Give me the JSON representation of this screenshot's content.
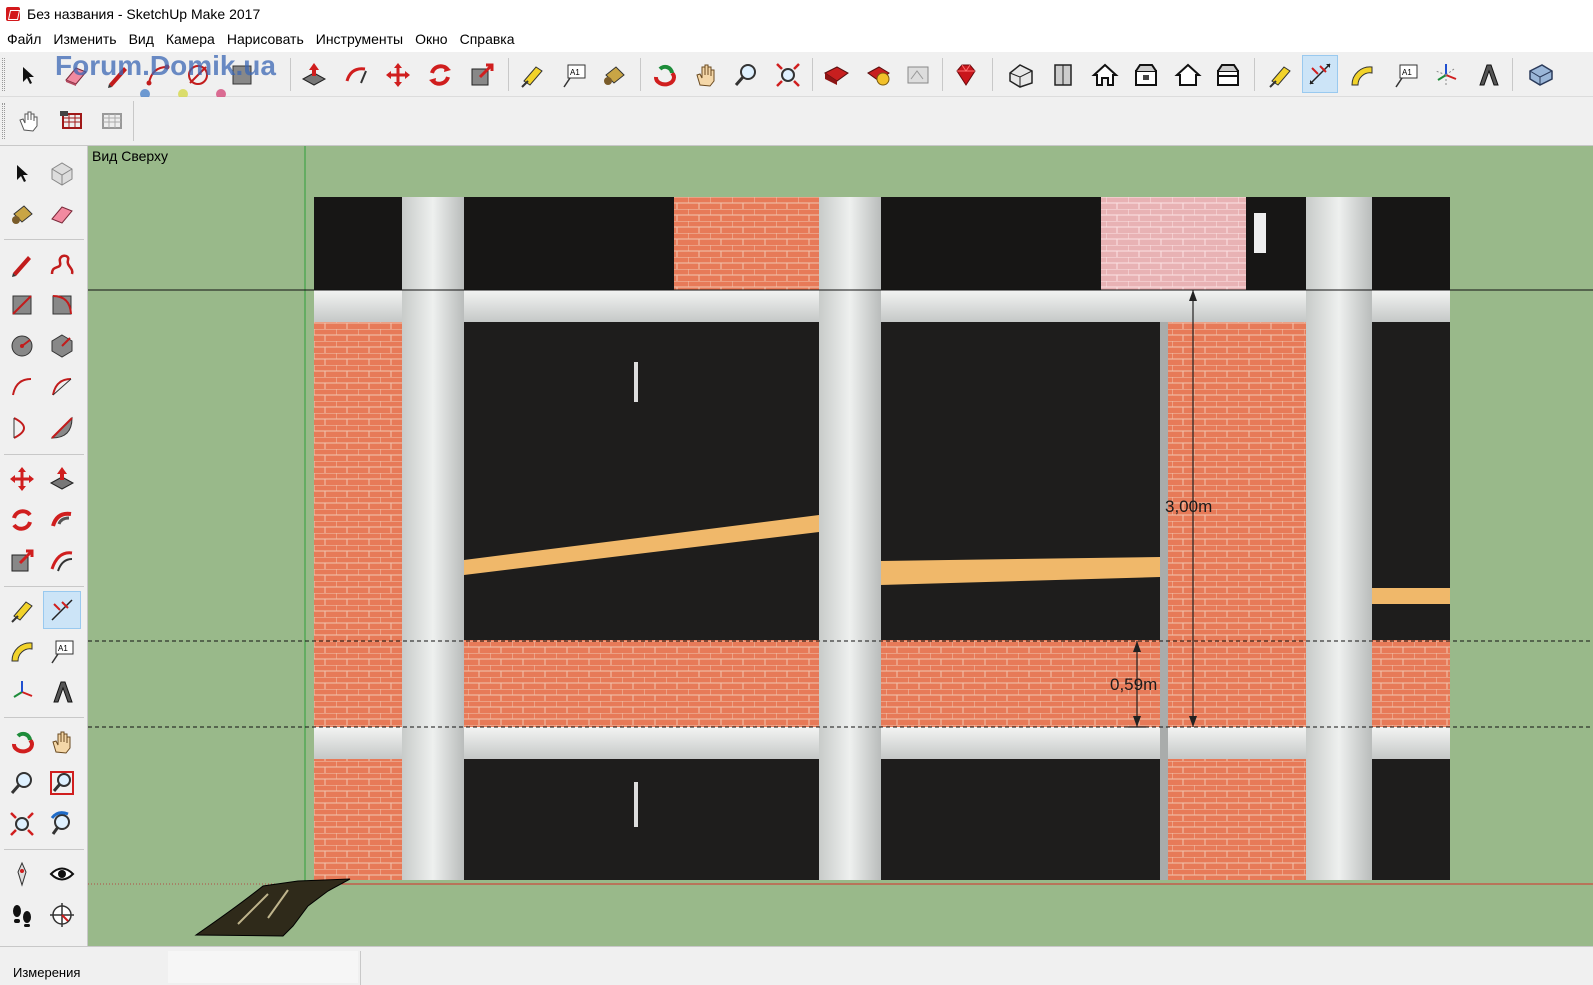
{
  "window": {
    "title": "Без названия - SketchUp Make 2017"
  },
  "menu": [
    "Файл",
    "Изменить",
    "Вид",
    "Камера",
    "Нарисовать",
    "Инструменты",
    "Окно",
    "Справка"
  ],
  "watermark": "Forum.Domik.ua",
  "toolbar": {
    "top_buttons": [
      "select-icon",
      "eraser-icon",
      "pencil-icon",
      "arc-icon",
      "rectangle-icon",
      "push-pull-icon",
      "follow-me-icon",
      "move-icon",
      "rotate-icon",
      "scale-icon",
      "tape-measure-icon",
      "text-icon",
      "paint-bucket-icon",
      "orbit-icon",
      "pan-icon",
      "zoom-icon",
      "zoom-extents-icon",
      "warehouse-icon",
      "extension-warehouse-icon",
      "layout-icon",
      "ruby-icon",
      "iso-view-icon",
      "top-view-icon",
      "front-view-icon",
      "right-view-icon",
      "back-view-icon",
      "left-view-icon",
      "tape-measure-icon",
      "dimension-icon",
      "protractor-icon",
      "text-icon",
      "axes-icon",
      "3d-text-icon",
      "section-icon"
    ],
    "second_row": [
      "hand-icon",
      "photo-match-icon",
      "photo-match-grid-icon"
    ],
    "active_tool": "dimension-icon"
  },
  "palette": {
    "tools": [
      "select-icon",
      "make-component-icon",
      "paint-bucket-icon",
      "eraser-icon",
      "line-icon",
      "freehand-icon",
      "rectangle-icon",
      "rotated-rectangle-icon",
      "circle-icon",
      "polygon-icon",
      "arc-icon",
      "two-point-arc-icon",
      "three-point-arc-icon",
      "pie-icon",
      "move-icon",
      "push-pull-icon",
      "rotate-icon",
      "follow-me-icon",
      "scale-icon",
      "offset-icon",
      "tape-measure-icon",
      "dimension-icon",
      "protractor-icon",
      "text-icon",
      "axes-icon",
      "3d-text-icon",
      "orbit-icon",
      "pan-icon",
      "zoom-icon",
      "zoom-window-icon",
      "zoom-extents-icon",
      "previous-view-icon",
      "position-camera-icon",
      "look-around-icon",
      "walk-icon",
      "section-plane-icon"
    ],
    "active_tool": "dimension-icon"
  },
  "viewport": {
    "view_name": "Вид Сверху",
    "dimensions": [
      "3,00m",
      "0,59m"
    ]
  },
  "status": {
    "label": "Измерения"
  }
}
